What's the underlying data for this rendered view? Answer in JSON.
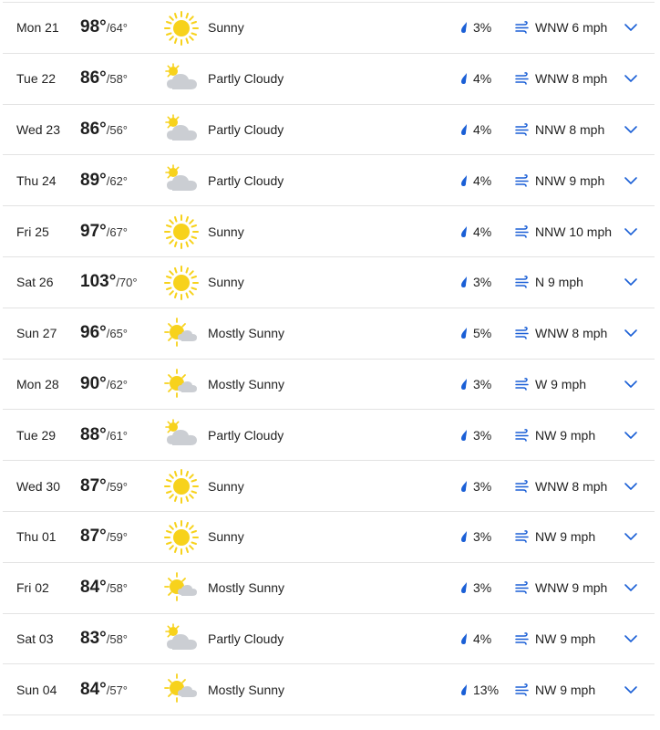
{
  "colors": {
    "accent": "#1a5fd6",
    "sun": "#f7d21c",
    "cloud": "#c9cdd2",
    "divider": "#e3e3e3"
  },
  "days": [
    {
      "day": "Mon 21",
      "hi": "98°",
      "lo": "/64°",
      "icon": "sunny",
      "condition": "Sunny",
      "precip": "3%",
      "wind": "WNW 6 mph"
    },
    {
      "day": "Tue 22",
      "hi": "86°",
      "lo": "/58°",
      "icon": "partly-cloudy",
      "condition": "Partly Cloudy",
      "precip": "4%",
      "wind": "WNW 8 mph"
    },
    {
      "day": "Wed 23",
      "hi": "86°",
      "lo": "/56°",
      "icon": "partly-cloudy",
      "condition": "Partly Cloudy",
      "precip": "4%",
      "wind": "NNW 8 mph"
    },
    {
      "day": "Thu 24",
      "hi": "89°",
      "lo": "/62°",
      "icon": "partly-cloudy",
      "condition": "Partly Cloudy",
      "precip": "4%",
      "wind": "NNW 9 mph"
    },
    {
      "day": "Fri 25",
      "hi": "97°",
      "lo": "/67°",
      "icon": "sunny",
      "condition": "Sunny",
      "precip": "4%",
      "wind": "NNW 10 mph"
    },
    {
      "day": "Sat 26",
      "hi": "103°",
      "lo": "/70°",
      "icon": "sunny",
      "condition": "Sunny",
      "precip": "3%",
      "wind": "N 9 mph"
    },
    {
      "day": "Sun 27",
      "hi": "96°",
      "lo": "/65°",
      "icon": "mostly-sunny",
      "condition": "Mostly Sunny",
      "precip": "5%",
      "wind": "WNW 8 mph"
    },
    {
      "day": "Mon 28",
      "hi": "90°",
      "lo": "/62°",
      "icon": "mostly-sunny",
      "condition": "Mostly Sunny",
      "precip": "3%",
      "wind": "W 9 mph"
    },
    {
      "day": "Tue 29",
      "hi": "88°",
      "lo": "/61°",
      "icon": "partly-cloudy",
      "condition": "Partly Cloudy",
      "precip": "3%",
      "wind": "NW 9 mph"
    },
    {
      "day": "Wed 30",
      "hi": "87°",
      "lo": "/59°",
      "icon": "sunny",
      "condition": "Sunny",
      "precip": "3%",
      "wind": "WNW 8 mph"
    },
    {
      "day": "Thu 01",
      "hi": "87°",
      "lo": "/59°",
      "icon": "sunny",
      "condition": "Sunny",
      "precip": "3%",
      "wind": "NW 9 mph"
    },
    {
      "day": "Fri 02",
      "hi": "84°",
      "lo": "/58°",
      "icon": "mostly-sunny",
      "condition": "Mostly Sunny",
      "precip": "3%",
      "wind": "WNW 9 mph"
    },
    {
      "day": "Sat 03",
      "hi": "83°",
      "lo": "/58°",
      "icon": "partly-cloudy",
      "condition": "Partly Cloudy",
      "precip": "4%",
      "wind": "NW 9 mph"
    },
    {
      "day": "Sun 04",
      "hi": "84°",
      "lo": "/57°",
      "icon": "mostly-sunny",
      "condition": "Mostly Sunny",
      "precip": "13%",
      "wind": "NW 9 mph"
    }
  ]
}
